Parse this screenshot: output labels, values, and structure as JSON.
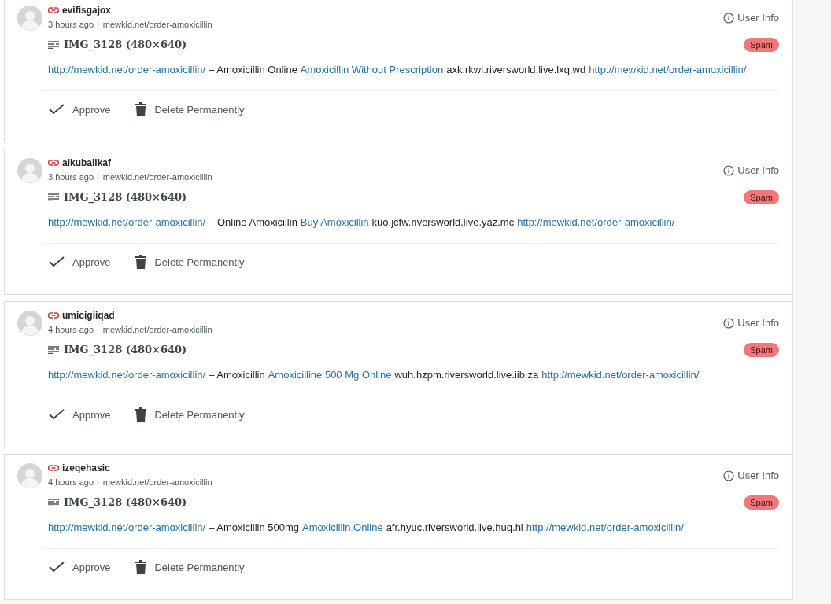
{
  "comments": [
    {
      "author": "evifisgajox",
      "time": "3 hours ago",
      "separator": "·",
      "site": "mewkid.net/order-amoxicillin",
      "user_info": "User Info",
      "post": "IMG_3128 (480×640)",
      "status": "Spam",
      "segments": [
        {
          "kind": "link",
          "text": "http://mewkid.net/order-amoxicillin/"
        },
        {
          "kind": "text",
          "text": "– Amoxicillin Online"
        },
        {
          "kind": "link",
          "text": "Amoxicillin Without Prescription"
        },
        {
          "kind": "text",
          "text": "axk.rkwl.riversworld.live.lxq.wd"
        },
        {
          "kind": "link",
          "text": "http://mewkid.net/order-amoxicillin/"
        }
      ],
      "actions": [
        "Approve",
        "Delete Permanently"
      ]
    },
    {
      "author": "aikubailkaf",
      "time": "3 hours ago",
      "separator": "·",
      "site": "mewkid.net/order-amoxicillin",
      "user_info": "User Info",
      "post": "IMG_3128 (480×640)",
      "status": "Spam",
      "segments": [
        {
          "kind": "link",
          "text": "http://mewkid.net/order-amoxicillin/"
        },
        {
          "kind": "text",
          "text": "– Online Amoxicillin"
        },
        {
          "kind": "link",
          "text": "Buy Amoxicillin"
        },
        {
          "kind": "text",
          "text": "kuo.jcfw.riversworld.live.yaz.mc"
        },
        {
          "kind": "link",
          "text": "http://mewkid.net/order-amoxicillin/"
        }
      ],
      "actions": [
        "Approve",
        "Delete Permanently"
      ]
    },
    {
      "author": "umicigiiqad",
      "time": "4 hours ago",
      "separator": "·",
      "site": "mewkid.net/order-amoxicillin",
      "user_info": "User Info",
      "post": "IMG_3128 (480×640)",
      "status": "Spam",
      "segments": [
        {
          "kind": "link",
          "text": "http://mewkid.net/order-amoxicillin/"
        },
        {
          "kind": "text",
          "text": "– Amoxicillin"
        },
        {
          "kind": "link",
          "text": "Amoxicilline 500 Mg Online"
        },
        {
          "kind": "text",
          "text": "wuh.hzpm.riversworld.live.iib.za"
        },
        {
          "kind": "link",
          "text": "http://mewkid.net/order-amoxicillin/"
        }
      ],
      "actions": [
        "Approve",
        "Delete Permanently"
      ]
    },
    {
      "author": "izeqehasic",
      "time": "4 hours ago",
      "separator": "·",
      "site": "mewkid.net/order-amoxicillin",
      "user_info": "User Info",
      "post": "IMG_3128 (480×640)",
      "status": "Spam",
      "segments": [
        {
          "kind": "link",
          "text": "http://mewkid.net/order-amoxicillin/"
        },
        {
          "kind": "text",
          "text": "– Amoxicillin 500mg"
        },
        {
          "kind": "link",
          "text": "Amoxicillin Online"
        },
        {
          "kind": "text",
          "text": "afr.hyuc.riversworld.live.huq.hi"
        },
        {
          "kind": "link",
          "text": "http://mewkid.net/order-amoxicillin/"
        }
      ],
      "actions": [
        "Approve",
        "Delete Permanently"
      ]
    }
  ]
}
